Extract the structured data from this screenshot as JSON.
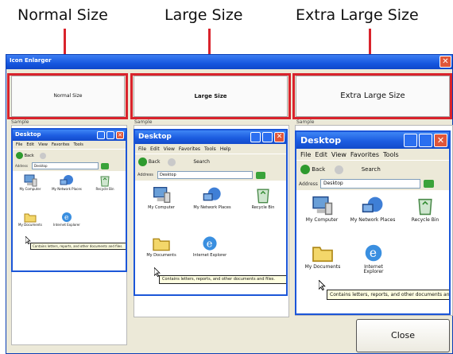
{
  "captions": {
    "normal": "Normal Size",
    "large": "Large Size",
    "extra": "Extra Large Size"
  },
  "window": {
    "title": "Icon Enlarger",
    "close_glyph": "✕"
  },
  "buttons": {
    "normal": "Normal Size",
    "large": "Large Size",
    "extra": "Extra Large Size",
    "close": "Close"
  },
  "sample_label": "Sample",
  "explorer": {
    "title": "Desktop",
    "menu": [
      "File",
      "Edit",
      "View",
      "Favorites",
      "Tools",
      "Help"
    ],
    "back": "Back",
    "search": "Search",
    "address_label": "Address",
    "address_value": "Desktop",
    "go": "Go",
    "icons": [
      "My Computer",
      "My Network Places",
      "Recycle Bin",
      "My Documents",
      "Internet Explorer"
    ],
    "tooltip": "Contains letters, reports, and other documents and files."
  },
  "colors": {
    "highlight_red": "#d9232c",
    "xp_blue": "#1c56d8"
  }
}
